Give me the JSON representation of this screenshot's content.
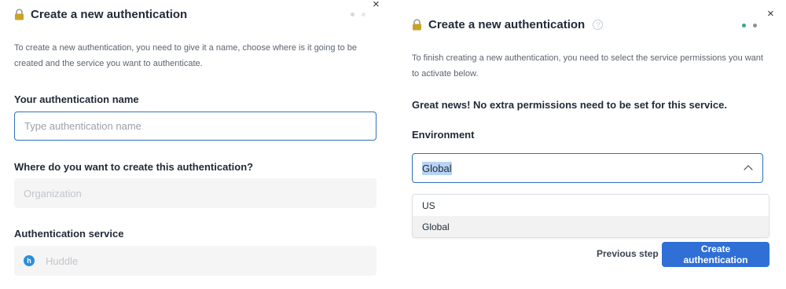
{
  "colors": {
    "accent": "#2f6fd6",
    "focus_border": "#2f6fbf",
    "step_active_dot": "#3aa776",
    "step_inactive_dot": "#d4d8dd",
    "lock_gold": "#c9a227"
  },
  "left_panel": {
    "title": "Create a new authentication",
    "close_glyph": "×",
    "description": "To create a new authentication, you need to give it a name, choose where is it going to be created and the service you want to authenticate.",
    "name_label": "Your authentication name",
    "name_input": {
      "value": "",
      "placeholder": "Type authentication name"
    },
    "location_label": "Where do you want to create this authentication?",
    "location_placeholder": "Organization",
    "service_label": "Authentication service",
    "service_name": "Huddle",
    "service_logo_letter": "h",
    "steps": [
      "active",
      "inactive"
    ]
  },
  "right_panel": {
    "title": "Create a new authentication",
    "help_glyph": "?",
    "close_glyph": "×",
    "description": "To finish creating a new authentication, you need to select the service permissions you want to activate below.",
    "permissions_notice": "Great news! No extra permissions need to be set for this service.",
    "environment_label": "Environment",
    "environment_selected": "Global",
    "environment_options": [
      "US",
      "Global"
    ],
    "previous_label": "Previous step",
    "create_label": "Create authentication",
    "steps": [
      "active",
      "active"
    ]
  },
  "icons": {
    "lock": "lock-icon",
    "help": "help-icon",
    "close": "close-icon",
    "chevron": "chevron-up-icon",
    "service": "huddle-logo-icon"
  }
}
